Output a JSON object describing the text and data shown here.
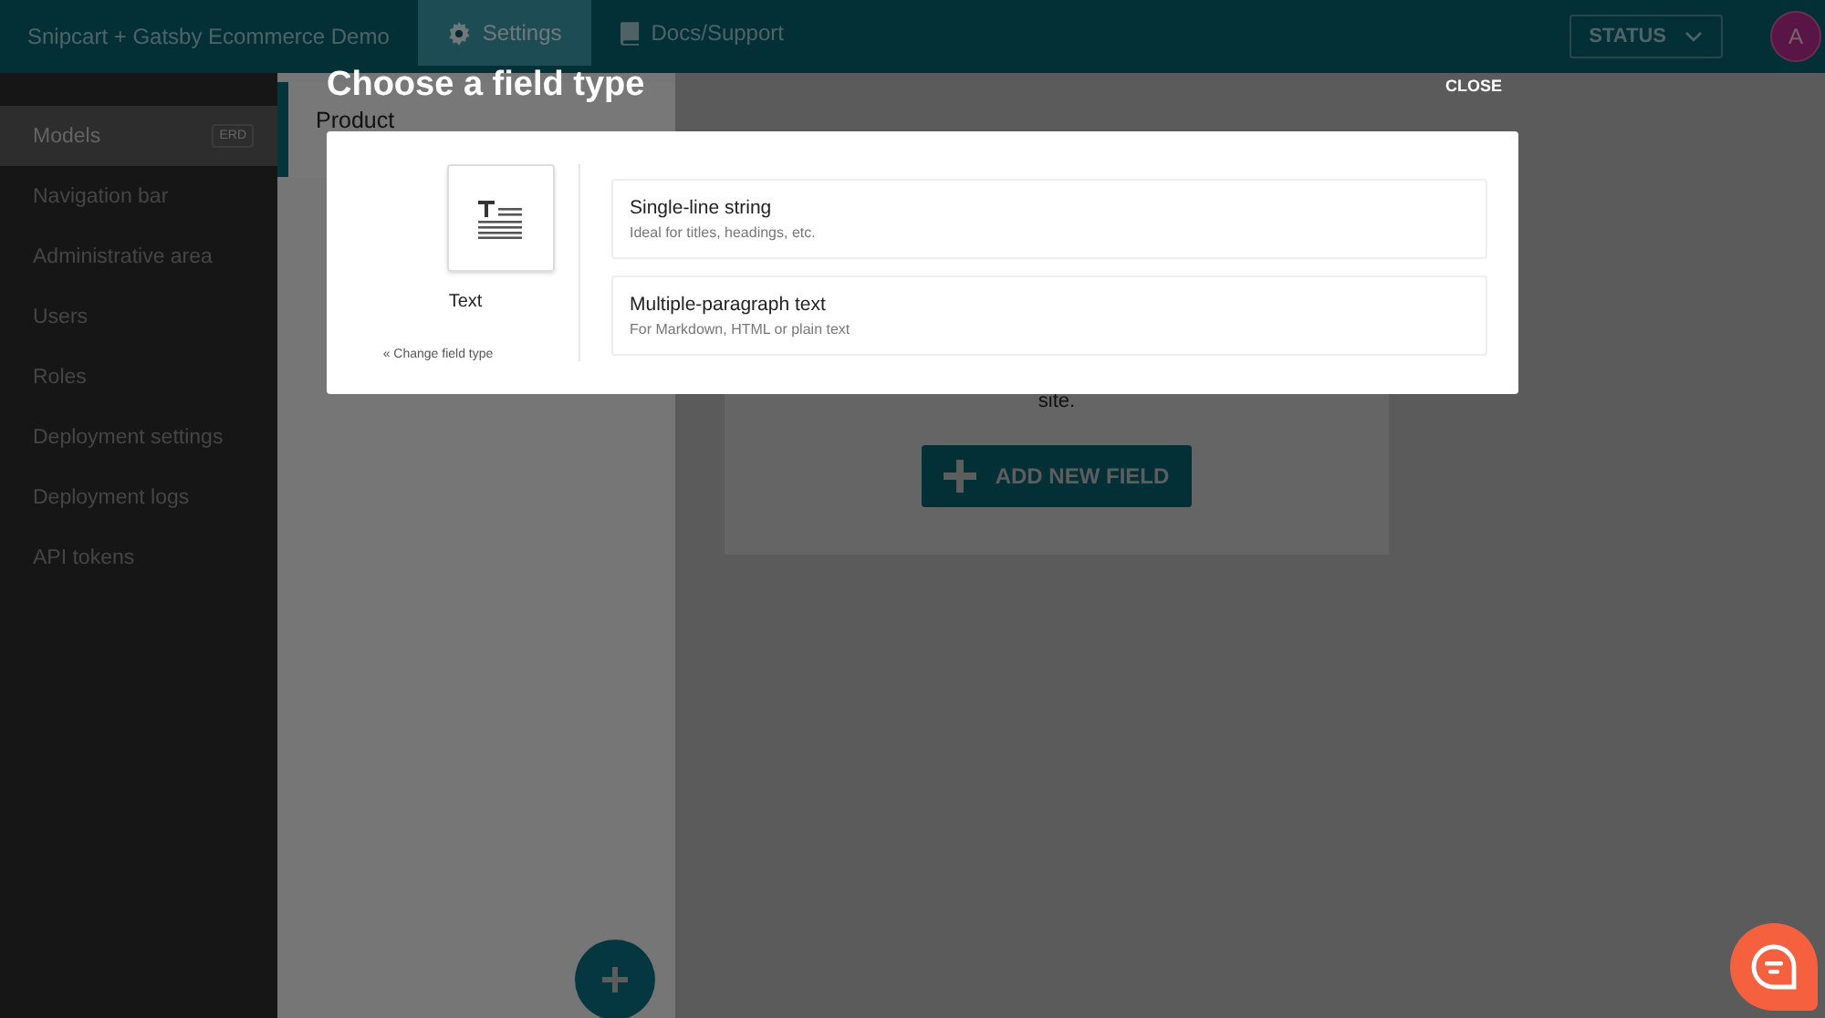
{
  "app_bar": {
    "title": "Snipcart + Gatsby Ecommerce Demo",
    "tabs": [
      {
        "label": "Settings",
        "selected": true
      },
      {
        "label": "Docs/Support",
        "selected": false
      }
    ],
    "status_button": {
      "label": "STATUS"
    },
    "avatar": {
      "initial": "A"
    }
  },
  "sidebar": {
    "items": [
      {
        "label": "Models",
        "selected": true,
        "badge": "ERD"
      },
      {
        "label": "Navigation bar",
        "selected": false
      },
      {
        "label": "Administrative area",
        "selected": false
      },
      {
        "label": "Users",
        "selected": false
      },
      {
        "label": "Roles",
        "selected": false
      },
      {
        "label": "Deployment settings",
        "selected": false
      },
      {
        "label": "Deployment logs",
        "selected": false
      },
      {
        "label": "API tokens",
        "selected": false
      }
    ]
  },
  "model_list": {
    "items": [
      {
        "label": "Product",
        "selected": true
      }
    ]
  },
  "fields_card": {
    "text": "site.",
    "button": "ADD NEW FIELD"
  },
  "modal": {
    "title": "Choose a field type",
    "close": "CLOSE",
    "field_type": {
      "label": "Text",
      "change_link": "« Change field type"
    },
    "options": [
      {
        "title": "Single-line string",
        "description": "Ideal for titles, headings, etc."
      },
      {
        "title": "Multiple-paragraph text",
        "description": "For Markdown, HTML or plain text"
      }
    ]
  }
}
